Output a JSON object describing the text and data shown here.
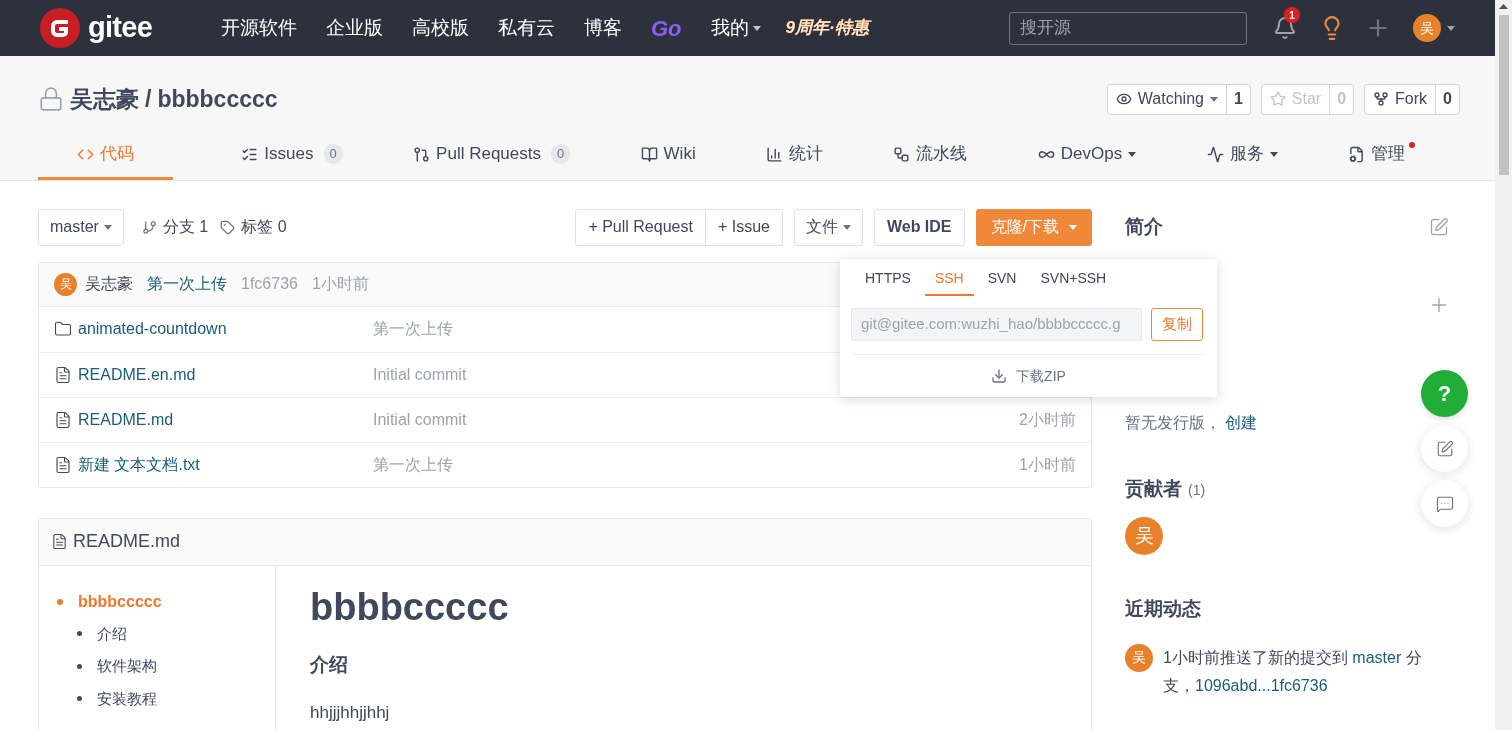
{
  "navbar": {
    "logo": "gitee",
    "links": [
      {
        "label": "开源软件",
        "kind": "text"
      },
      {
        "label": "企业版",
        "kind": "text"
      },
      {
        "label": "高校版",
        "kind": "text"
      },
      {
        "label": "私有云",
        "kind": "text"
      },
      {
        "label": "博客",
        "kind": "text"
      },
      {
        "label": "Go",
        "kind": "brand"
      },
      {
        "label": "我的",
        "kind": "menu"
      }
    ],
    "promo": "9周年·特惠",
    "search": {
      "placeholder": "搜开源"
    },
    "notification_count": "1",
    "avatar": "吴"
  },
  "repo": {
    "owner": "吴志豪",
    "separator": "/",
    "name": "bbbbccccc",
    "actions": [
      {
        "label": "Watching",
        "count": "1",
        "menu": true,
        "disabled": false
      },
      {
        "label": "Star",
        "count": "0",
        "menu": false,
        "disabled": true
      },
      {
        "label": "Fork",
        "count": "0",
        "menu": false,
        "disabled": false
      }
    ]
  },
  "tabs": [
    {
      "label": "代码",
      "selected": true,
      "menu": false,
      "dot": false
    },
    {
      "label": "Issues",
      "badge": "0",
      "selected": false,
      "menu": false,
      "dot": false
    },
    {
      "label": "Pull Requests",
      "badge": "0",
      "selected": false,
      "menu": false,
      "dot": false
    },
    {
      "label": "Wiki",
      "selected": false,
      "menu": false,
      "dot": false
    },
    {
      "label": "统计",
      "selected": false,
      "menu": false,
      "dot": false
    },
    {
      "label": "流水线",
      "selected": false,
      "menu": false,
      "dot": false
    },
    {
      "label": "DevOps",
      "selected": false,
      "menu": true,
      "dot": false
    },
    {
      "label": "服务",
      "selected": false,
      "menu": true,
      "dot": false
    },
    {
      "label": "管理",
      "selected": false,
      "menu": false,
      "dot": true
    }
  ],
  "toolbar": {
    "branch": "master",
    "branches": "分支 1",
    "tags": "标签 0",
    "new_buttons": [
      "+ Pull Request",
      "+ Issue"
    ],
    "file_menu": "文件",
    "web_ide": "Web IDE",
    "clone": "克隆/下载"
  },
  "last_commit": {
    "avatar": "吴",
    "author": "吴志豪",
    "message": "第一次上传",
    "hash": "1fc6736",
    "time": "1小时前"
  },
  "files": [
    {
      "kind": "folder",
      "name": "animated-countdown",
      "message": "第一次上传"
    },
    {
      "kind": "file",
      "name": "README.en.md",
      "message": "Initial commit"
    },
    {
      "kind": "file",
      "name": "README.md",
      "message": "Initial commit",
      "time": "2小时前"
    },
    {
      "kind": "file",
      "name": "新建 文本文档.txt",
      "message": "第一次上传",
      "time": "1小时前"
    }
  ],
  "clone_menu": {
    "tabs": [
      {
        "label": "HTTPS",
        "selected": false
      },
      {
        "label": "SSH",
        "selected": true
      },
      {
        "label": "SVN",
        "selected": false
      },
      {
        "label": "SVN+SSH",
        "selected": false
      }
    ],
    "url": "git@gitee.com:wuzhi_hao/bbbbccccc.g",
    "copy": "复制",
    "download": "下载ZIP"
  },
  "readme": {
    "title": "README.md",
    "toc": [
      {
        "label": "bbbbccccc",
        "selected": true,
        "children": [
          {
            "label": "介绍",
            "selected": false
          },
          {
            "label": "软件架构",
            "selected": false
          },
          {
            "label": "安装教程",
            "selected": false
          }
        ]
      }
    ],
    "heading": "bbbbccccc",
    "subheading": "介绍",
    "paragraph": "hhjjjhhjjhhj"
  },
  "sidebar": {
    "intro_title": "简介",
    "releases_text": "暂无发行版，",
    "releases_link": "创建",
    "contributors_title": "贡献者",
    "contributors_count": "(1)",
    "contributors": [
      "吴"
    ],
    "activity_title": "近期动态",
    "activity": [
      {
        "avatar": "吴",
        "text": "1小时前推送了新的提交到 ",
        "branch": "master",
        "text2": " 分支，",
        "commits": "1096abd...1fc6736"
      }
    ]
  },
  "floating": {
    "help": "?"
  }
}
